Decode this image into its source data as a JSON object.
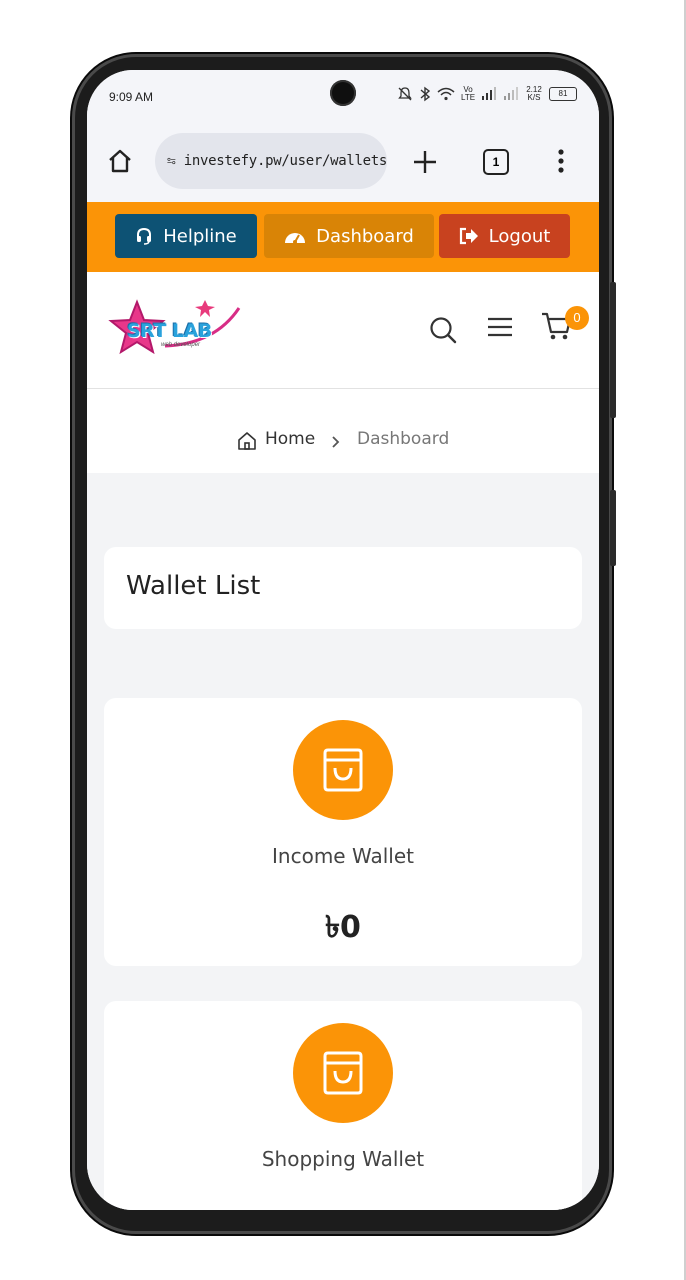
{
  "status": {
    "time": "9:09 AM",
    "volte": "Vo LTE",
    "speed": "2.12 K/S",
    "battery": "81"
  },
  "browser": {
    "url": "investefy.pw/user/wallets",
    "tab_count": "1"
  },
  "topbar": {
    "helpline": "Helpline",
    "dashboard": "Dashboard",
    "logout": "Logout"
  },
  "header": {
    "logo_text": "SRT LAB",
    "logo_sub": "web developer",
    "cart_count": "0"
  },
  "breadcrumb": {
    "home": "Home",
    "current": "Dashboard"
  },
  "page": {
    "title": "Wallet List"
  },
  "wallets": [
    {
      "label": "Income Wallet",
      "amount": "৳0"
    },
    {
      "label": "Shopping Wallet"
    }
  ],
  "colors": {
    "accent": "#fb9407",
    "helpline": "#0d5274",
    "logout": "#c8421f"
  }
}
